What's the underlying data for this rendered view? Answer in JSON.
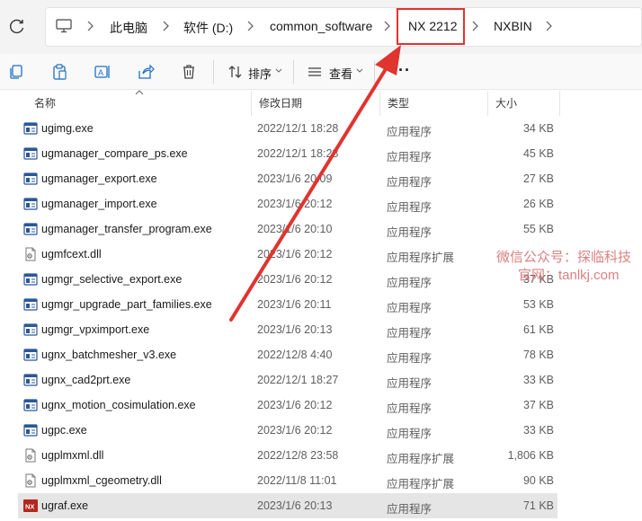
{
  "address_bar": {
    "breadcrumbs": [
      "此电脑",
      "软件 (D:)",
      "common_software",
      "NX 2212",
      "NXBIN"
    ],
    "highlighted": "NX 2212"
  },
  "toolbar": {
    "sort_label": "排序",
    "view_label": "查看",
    "more_label": "···",
    "icons": [
      "copy-icon",
      "paste-icon",
      "rename-icon",
      "share-icon",
      "delete-icon"
    ]
  },
  "columns": {
    "name": "名称",
    "modified": "修改日期",
    "type": "类型",
    "size": "大小"
  },
  "files": [
    {
      "name": "ugimg.exe",
      "modified": "2022/12/1 18:28",
      "type": "应用程序",
      "size": "34 KB",
      "icon": "app"
    },
    {
      "name": "ugmanager_compare_ps.exe",
      "modified": "2022/12/1 18:28",
      "type": "应用程序",
      "size": "45 KB",
      "icon": "app"
    },
    {
      "name": "ugmanager_export.exe",
      "modified": "2023/1/6 20:09",
      "type": "应用程序",
      "size": "27 KB",
      "icon": "app"
    },
    {
      "name": "ugmanager_import.exe",
      "modified": "2023/1/6 20:12",
      "type": "应用程序",
      "size": "26 KB",
      "icon": "app"
    },
    {
      "name": "ugmanager_transfer_program.exe",
      "modified": "2023/1/6 20:10",
      "type": "应用程序",
      "size": "55 KB",
      "icon": "app"
    },
    {
      "name": "ugmfcext.dll",
      "modified": "2023/1/6 20:12",
      "type": "应用程序扩展",
      "size": "",
      "icon": "dll"
    },
    {
      "name": "ugmgr_selective_export.exe",
      "modified": "2023/1/6 20:12",
      "type": "应用程序",
      "size": "37 KB",
      "icon": "app"
    },
    {
      "name": "ugmgr_upgrade_part_families.exe",
      "modified": "2023/1/6 20:11",
      "type": "应用程序",
      "size": "53 KB",
      "icon": "app"
    },
    {
      "name": "ugmgr_vpximport.exe",
      "modified": "2023/1/6 20:13",
      "type": "应用程序",
      "size": "61 KB",
      "icon": "app"
    },
    {
      "name": "ugnx_batchmesher_v3.exe",
      "modified": "2022/12/8 4:40",
      "type": "应用程序",
      "size": "78 KB",
      "icon": "app"
    },
    {
      "name": "ugnx_cad2prt.exe",
      "modified": "2022/12/1 18:27",
      "type": "应用程序",
      "size": "33 KB",
      "icon": "app"
    },
    {
      "name": "ugnx_motion_cosimulation.exe",
      "modified": "2023/1/6 20:12",
      "type": "应用程序",
      "size": "37 KB",
      "icon": "app"
    },
    {
      "name": "ugpc.exe",
      "modified": "2023/1/6 20:12",
      "type": "应用程序",
      "size": "33 KB",
      "icon": "app"
    },
    {
      "name": "ugplmxml.dll",
      "modified": "2022/12/8 23:58",
      "type": "应用程序扩展",
      "size": "1,806 KB",
      "icon": "dll"
    },
    {
      "name": "ugplmxml_cgeometry.dll",
      "modified": "2022/11/8 11:01",
      "type": "应用程序扩展",
      "size": "90 KB",
      "icon": "dll"
    },
    {
      "name": "ugraf.exe",
      "modified": "2023/1/6 20:13",
      "type": "应用程序",
      "size": "71 KB",
      "icon": "nx",
      "selected": true
    }
  ],
  "watermark": {
    "line1": "微信公众号：探临科技",
    "line2": "官网：tanlkj.com"
  },
  "colors": {
    "highlight": "#e0342f",
    "selected_row": "#e5e5e5"
  }
}
